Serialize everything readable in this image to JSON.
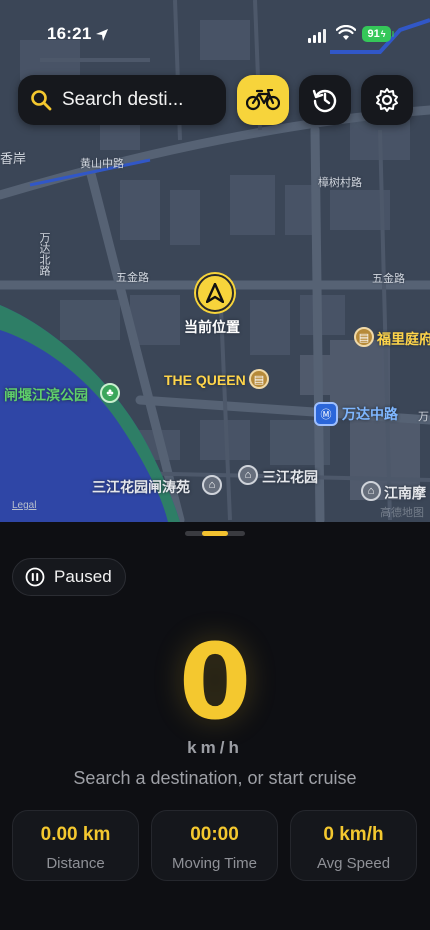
{
  "status_bar": {
    "time": "16:21",
    "battery": "91"
  },
  "search": {
    "placeholder": "Search desti..."
  },
  "map": {
    "labels": {
      "xiangan": "香岸",
      "huangshan_road": "黄山中路",
      "zhangshu_village_road": "樟树村路",
      "wanda_north_road": "万达北路",
      "wujin_road_left": "五金路",
      "wujin_road_right": "五金路",
      "current_position": "当前位置",
      "fuliting": "福里庭府",
      "the_queen": "THE QUEEN",
      "wanda_middle_road_station": "万达中路",
      "wan": "万",
      "zhayan_park": "闸堰江滨公园",
      "sanjiang_zhaotaoyuan": "三江花园闸涛苑",
      "sanjiang_garden": "三江花园",
      "jiangnan": "江南摩",
      "legal": "Legal",
      "watermark": "高德地图"
    }
  },
  "sheet": {
    "status_label": "Paused",
    "speed_value": "0",
    "speed_unit": "km/h",
    "hint": "Search a destination, or start cruise",
    "stats": [
      {
        "value": "0.00 km",
        "label": "Distance"
      },
      {
        "value": "00:00",
        "label": "Moving Time"
      },
      {
        "value": "0 km/h",
        "label": "Avg Speed"
      }
    ],
    "handle_progress": 0.43
  },
  "colors": {
    "accent": "#f4c82f",
    "map_bg": "#3a4556",
    "water": "#2f46a6",
    "park": "#2b7d63"
  },
  "icons": [
    "location-arrow-icon",
    "search-icon",
    "bicycle-icon",
    "history-icon",
    "gear-icon",
    "pause-icon",
    "navigation-arrow-icon",
    "tree-icon",
    "metro-icon",
    "building-icon"
  ]
}
